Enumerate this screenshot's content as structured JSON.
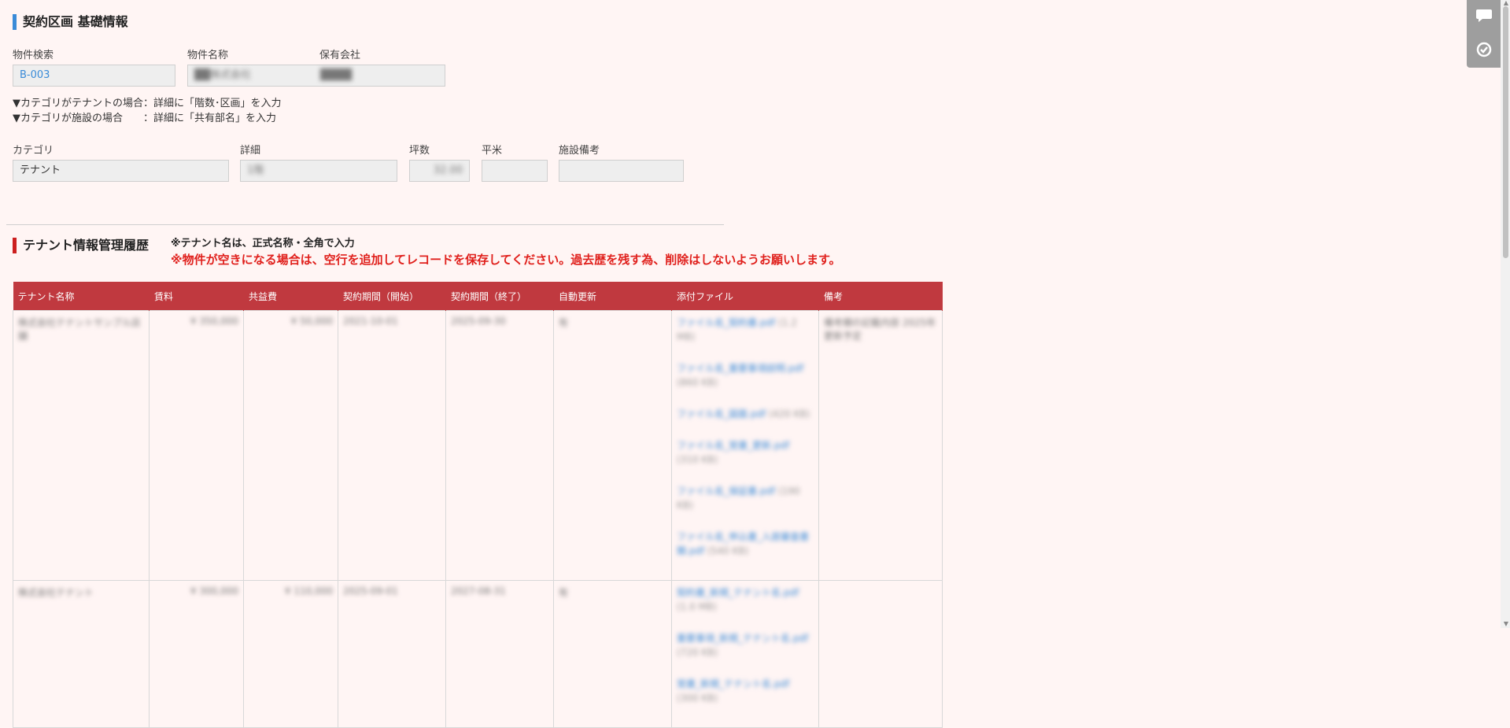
{
  "basic": {
    "heading": "契約区画 基礎情報",
    "labels": {
      "search": "物件検索",
      "name": "物件名称",
      "company": "保有会社"
    },
    "search_value": "B-003",
    "name_value": "██株式会社",
    "company_value": "████",
    "note1": "▼カテゴリがテナントの場合：詳細に「階数･区画」を入力",
    "note2": "▼カテゴリが施設の場合　　：詳細に「共有部名」を入力",
    "labels2": {
      "category": "カテゴリ",
      "detail": "詳細",
      "tsubo": "坪数",
      "heibei": "平米",
      "facility_note": "施設備考"
    },
    "category_value": "テナント",
    "detail_value": "1階",
    "tsubo_value": "32.00",
    "heibei_value": "",
    "facility_value": ""
  },
  "tenant": {
    "heading": "テナント情報管理履歴",
    "note_small": "※テナント名は、正式名称・全角で入力",
    "note_big": "※物件が空きになる場合は、空行を追加してレコードを保存してください。過去歴を残す為、削除はしないようお願いします。",
    "columns": [
      "テナント名称",
      "賃料",
      "共益費",
      "契約期間（開始）",
      "契約期間（終了）",
      "自動更新",
      "添付ファイル",
      "備考"
    ],
    "rows": [
      {
        "name": "株式会社テナントサンプル店舗",
        "rent": "¥ 350,000",
        "fee": "¥ 50,000",
        "start": "2021-10-01",
        "end": "2025-09-30",
        "auto": "有",
        "files": [
          {
            "name": "ファイル名_契約書.pdf",
            "size": "(1.2 MB)"
          },
          {
            "name": "ファイル名_重要事項説明.pdf",
            "size": "(860 KB)"
          },
          {
            "name": "ファイル名_図面.pdf",
            "size": "(420 KB)"
          },
          {
            "name": "ファイル名_覚書_更新.pdf",
            "size": "(310 KB)"
          },
          {
            "name": "ファイル名_保証書.pdf",
            "size": "(190 KB)"
          },
          {
            "name": "ファイル名_申込書_入居審査書類.pdf",
            "size": "(540 KB)"
          }
        ],
        "memo": "備考欄の記載内容 2025年更新予定"
      },
      {
        "name": "株式会社テナント",
        "rent": "¥ 300,000",
        "fee": "¥ 110,000",
        "start": "2025-09-01",
        "end": "2027-08-31",
        "auto": "有",
        "files": [
          {
            "name": "契約書_新規_テナント名.pdf",
            "size": "(1.0 MB)"
          },
          {
            "name": "重要事項_新規_テナント名.pdf",
            "size": "(720 KB)"
          },
          {
            "name": "覚書_新規_テナント名.pdf",
            "size": "(300 KB)"
          }
        ],
        "memo": ""
      }
    ]
  },
  "side": {
    "comment_icon": "comment-icon",
    "refresh_icon": "refresh-check-icon"
  }
}
